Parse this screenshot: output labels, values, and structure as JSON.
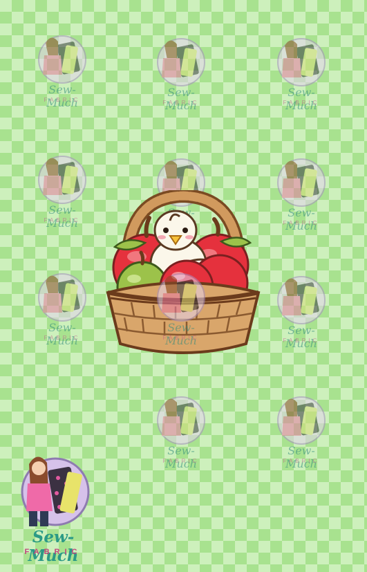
{
  "watermark": {
    "brand": "Sew-Much",
    "sub": "FABRIC"
  },
  "logo": {
    "brand": "Sew-Much",
    "sub": "FABRIC"
  },
  "colors": {
    "checker_dark": "#a8e28f",
    "checker_light": "#cdf0bc",
    "brand_teal": "#2b9a86",
    "brand_pink": "#c2447c",
    "apple_red": "#e8353f",
    "apple_green": "#9cc24a",
    "basket_tan": "#d9a66b"
  },
  "illustration": "duck-in-apple-basket"
}
